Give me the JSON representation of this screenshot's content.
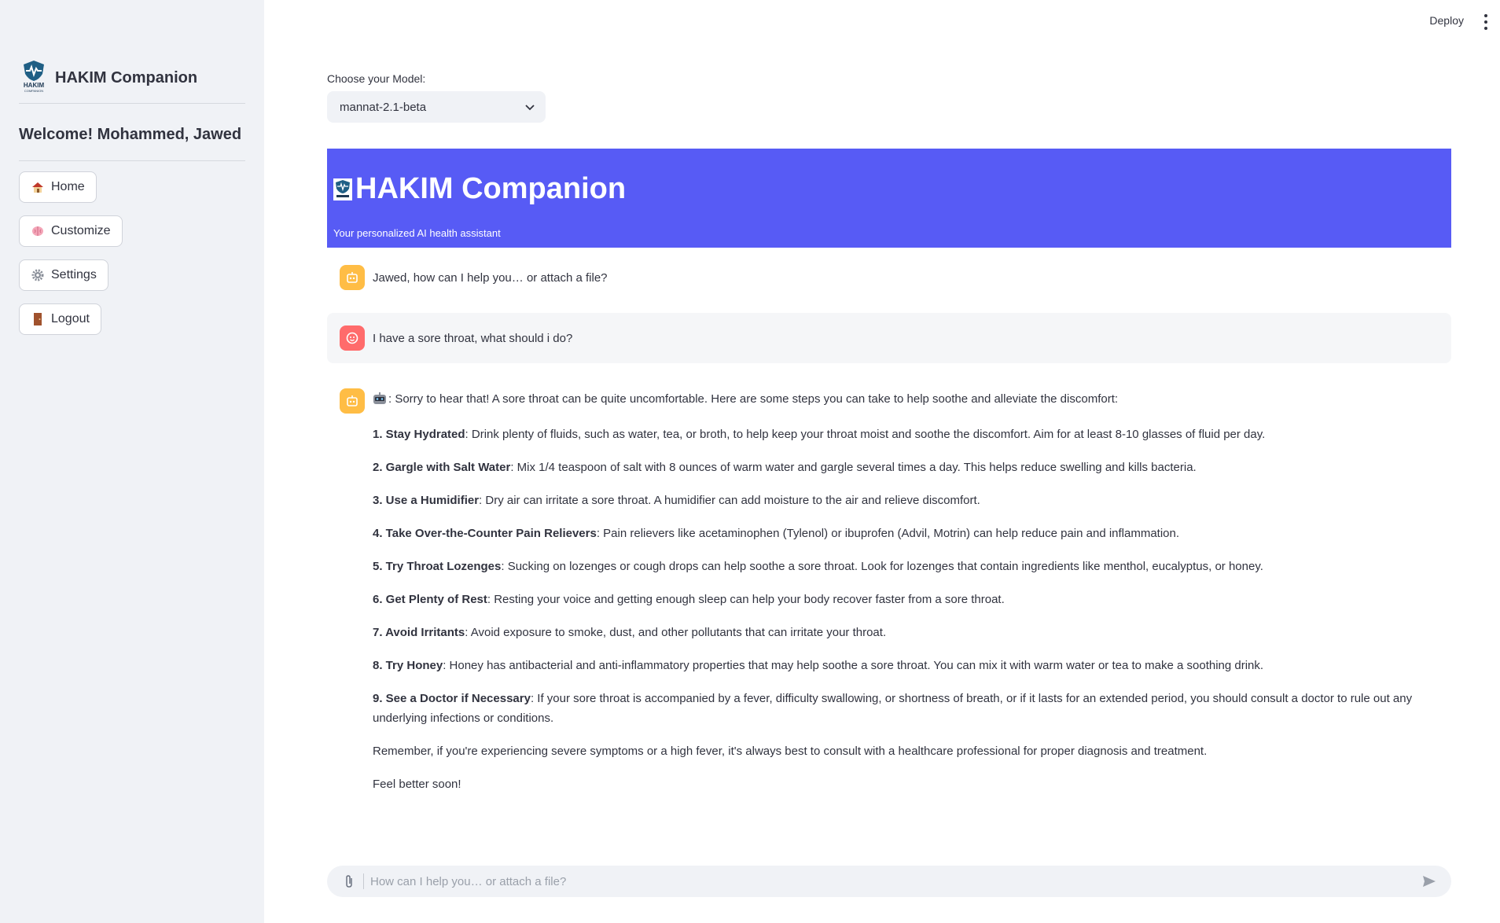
{
  "sidebar": {
    "brand_name": "HAKIM Companion",
    "logo_text": "HAKIM",
    "logo_subtext": "COMPANION",
    "welcome": "Welcome! Mohammed, Jawed",
    "nav": [
      {
        "label": "Home",
        "icon": "house-icon"
      },
      {
        "label": "Customize",
        "icon": "brain-icon"
      },
      {
        "label": "Settings",
        "icon": "gear-icon"
      },
      {
        "label": "Logout",
        "icon": "door-icon"
      }
    ]
  },
  "topbar": {
    "deploy_label": "Deploy",
    "menu_icon": "kebab-menu-icon"
  },
  "model": {
    "label": "Choose your Model:",
    "selected": "mannat-2.1-beta"
  },
  "banner": {
    "title": "HAKIM Companion",
    "subtitle": "Your personalized AI health assistant",
    "background": "#575bf5"
  },
  "chat": {
    "greeting": "Jawed, how can I help you… or attach a file?",
    "user_message": "I have a sore throat, what should i do?",
    "response": {
      "intro": ": Sorry to hear that! A sore throat can be quite uncomfortable. Here are some steps you can take to help soothe and alleviate the discomfort:",
      "steps": [
        {
          "title": "1. Stay Hydrated",
          "text": ": Drink plenty of fluids, such as water, tea, or broth, to help keep your throat moist and soothe the discomfort. Aim for at least 8-10 glasses of fluid per day."
        },
        {
          "title": "2. Gargle with Salt Water",
          "text": ": Mix 1/4 teaspoon of salt with 8 ounces of warm water and gargle several times a day. This helps reduce swelling and kills bacteria."
        },
        {
          "title": "3. Use a Humidifier",
          "text": ": Dry air can irritate a sore throat. A humidifier can add moisture to the air and relieve discomfort."
        },
        {
          "title": "4. Take Over-the-Counter Pain Relievers",
          "text": ": Pain relievers like acetaminophen (Tylenol) or ibuprofen (Advil, Motrin) can help reduce pain and inflammation."
        },
        {
          "title": "5. Try Throat Lozenges",
          "text": ": Sucking on lozenges or cough drops can help soothe a sore throat. Look for lozenges that contain ingredients like menthol, eucalyptus, or honey."
        },
        {
          "title": "6. Get Plenty of Rest",
          "text": ": Resting your voice and getting enough sleep can help your body recover faster from a sore throat."
        },
        {
          "title": "7. Avoid Irritants",
          "text": ": Avoid exposure to smoke, dust, and other pollutants that can irritate your throat."
        },
        {
          "title": "8. Try Honey",
          "text": ": Honey has antibacterial and anti-inflammatory properties that may help soothe a sore throat. You can mix it with warm water or tea to make a soothing drink."
        },
        {
          "title": "9. See a Doctor if Necessary",
          "text": ": If your sore throat is accompanied by a fever, difficulty swallowing, or shortness of breath, or if it lasts for an extended period, you should consult a doctor to rule out any underlying infections or conditions."
        }
      ],
      "closing": "Remember, if you're experiencing severe symptoms or a high fever, it's always best to consult with a healthcare professional for proper diagnosis and treatment.",
      "signoff": "Feel better soon!"
    }
  },
  "input": {
    "placeholder": "How can I help you… or attach a file?"
  }
}
